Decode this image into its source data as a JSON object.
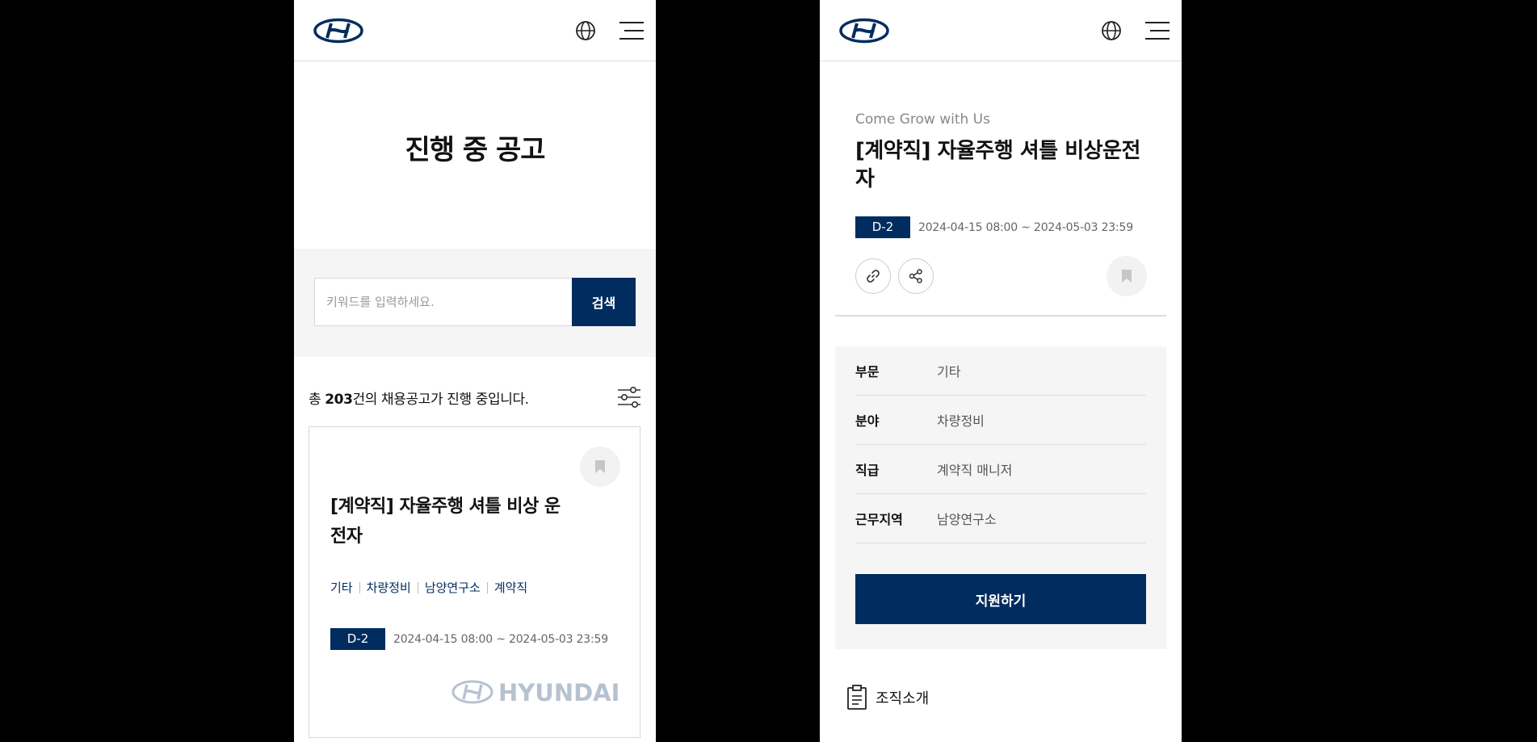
{
  "left": {
    "page_title": "진행 중 공고",
    "search": {
      "placeholder": "키워드를 입력하세요.",
      "button_label": "검색"
    },
    "count": {
      "prefix": "총 ",
      "number": "203",
      "suffix": "건의 채용공고가 진행 중입니다."
    },
    "card": {
      "title": "[계약직] 자율주행 셔틀 비상 운전자",
      "tags": [
        "기타",
        "차량정비",
        "남양연구소",
        "계약직"
      ],
      "dday": "D-2",
      "period": "2024-04-15 08:00 ~ 2024-05-03 23:59",
      "brand_text": "HYUNDAI"
    }
  },
  "right": {
    "tagline": "Come Grow with Us",
    "title": "[계약직] 자율주행 셔틀 비상운전자",
    "dday": "D-2",
    "period": "2024-04-15 08:00 ~ 2024-05-03 23:59",
    "info": [
      {
        "label": "부문",
        "value": "기타"
      },
      {
        "label": "분야",
        "value": "차량정비"
      },
      {
        "label": "직급",
        "value": "계약직 매니저"
      },
      {
        "label": "근무지역",
        "value": "남양연구소"
      }
    ],
    "apply_label": "지원하기",
    "org_label": "조직소개"
  },
  "icons": [
    "hyundai-logo-icon",
    "globe-icon",
    "menu-icon",
    "filter-icon",
    "bookmark-icon",
    "link-icon",
    "share-icon",
    "clipboard-icon"
  ],
  "colors": {
    "brand_navy": "#002c5f",
    "background": "#000000",
    "panel": "#f5f5f5"
  }
}
